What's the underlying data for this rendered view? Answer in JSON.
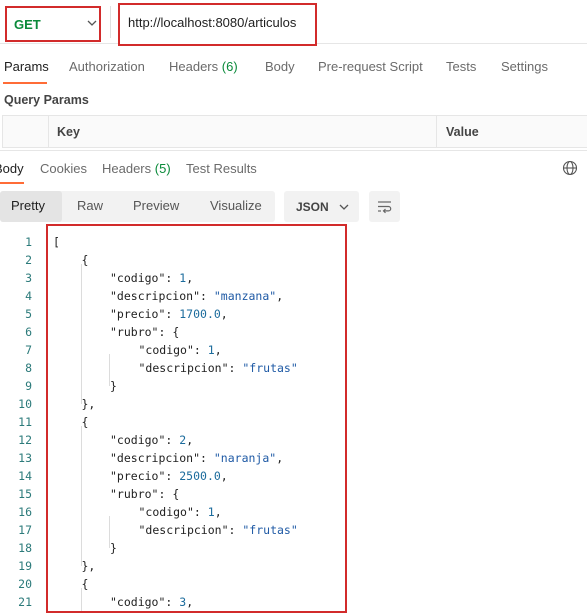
{
  "request": {
    "method": "GET",
    "url": "http://localhost:8080/articulos"
  },
  "request_tabs": [
    {
      "label": "Params",
      "count": ""
    },
    {
      "label": "Authorization",
      "count": ""
    },
    {
      "label": "Headers",
      "count": "(6)"
    },
    {
      "label": "Body",
      "count": ""
    },
    {
      "label": "Pre-request Script",
      "count": ""
    },
    {
      "label": "Tests",
      "count": ""
    },
    {
      "label": "Settings",
      "count": ""
    }
  ],
  "query_params": {
    "title": "Query Params",
    "columns": [
      "Key",
      "Value"
    ]
  },
  "response_tabs": [
    {
      "label": "Body",
      "count": ""
    },
    {
      "label": "Cookies",
      "count": ""
    },
    {
      "label": "Headers",
      "count": "(5)"
    },
    {
      "label": "Test Results",
      "count": ""
    }
  ],
  "view_modes": [
    "Pretty",
    "Raw",
    "Preview",
    "Visualize"
  ],
  "format": "JSON",
  "line_numbers": [
    "1",
    "2",
    "3",
    "4",
    "5",
    "6",
    "7",
    "8",
    "9",
    "10",
    "11",
    "12",
    "13",
    "14",
    "15",
    "16",
    "17",
    "18",
    "19",
    "20",
    "21"
  ],
  "code_lines": [
    {
      "indent": 0,
      "parts": [
        [
          "p",
          "["
        ]
      ]
    },
    {
      "indent": 1,
      "parts": [
        [
          "p",
          "{"
        ]
      ]
    },
    {
      "indent": 2,
      "parts": [
        [
          "k",
          "\"codigo\""
        ],
        [
          "p",
          ": "
        ],
        [
          "n",
          "1"
        ],
        [
          "p",
          ","
        ]
      ]
    },
    {
      "indent": 2,
      "parts": [
        [
          "k",
          "\"descripcion\""
        ],
        [
          "p",
          ": "
        ],
        [
          "s",
          "\"manzana\""
        ],
        [
          "p",
          ","
        ]
      ]
    },
    {
      "indent": 2,
      "parts": [
        [
          "k",
          "\"precio\""
        ],
        [
          "p",
          ": "
        ],
        [
          "n",
          "1700.0"
        ],
        [
          "p",
          ","
        ]
      ]
    },
    {
      "indent": 2,
      "parts": [
        [
          "k",
          "\"rubro\""
        ],
        [
          "p",
          ": {"
        ]
      ]
    },
    {
      "indent": 3,
      "parts": [
        [
          "k",
          "\"codigo\""
        ],
        [
          "p",
          ": "
        ],
        [
          "n",
          "1"
        ],
        [
          "p",
          ","
        ]
      ]
    },
    {
      "indent": 3,
      "parts": [
        [
          "k",
          "\"descripcion\""
        ],
        [
          "p",
          ": "
        ],
        [
          "s",
          "\"frutas\""
        ]
      ]
    },
    {
      "indent": 2,
      "parts": [
        [
          "p",
          "}"
        ]
      ]
    },
    {
      "indent": 1,
      "parts": [
        [
          "p",
          "},"
        ]
      ]
    },
    {
      "indent": 1,
      "parts": [
        [
          "p",
          "{"
        ]
      ]
    },
    {
      "indent": 2,
      "parts": [
        [
          "k",
          "\"codigo\""
        ],
        [
          "p",
          ": "
        ],
        [
          "n",
          "2"
        ],
        [
          "p",
          ","
        ]
      ]
    },
    {
      "indent": 2,
      "parts": [
        [
          "k",
          "\"descripcion\""
        ],
        [
          "p",
          ": "
        ],
        [
          "s",
          "\"naranja\""
        ],
        [
          "p",
          ","
        ]
      ]
    },
    {
      "indent": 2,
      "parts": [
        [
          "k",
          "\"precio\""
        ],
        [
          "p",
          ": "
        ],
        [
          "n",
          "2500.0"
        ],
        [
          "p",
          ","
        ]
      ]
    },
    {
      "indent": 2,
      "parts": [
        [
          "k",
          "\"rubro\""
        ],
        [
          "p",
          ": {"
        ]
      ]
    },
    {
      "indent": 3,
      "parts": [
        [
          "k",
          "\"codigo\""
        ],
        [
          "p",
          ": "
        ],
        [
          "n",
          "1"
        ],
        [
          "p",
          ","
        ]
      ]
    },
    {
      "indent": 3,
      "parts": [
        [
          "k",
          "\"descripcion\""
        ],
        [
          "p",
          ": "
        ],
        [
          "s",
          "\"frutas\""
        ]
      ]
    },
    {
      "indent": 2,
      "parts": [
        [
          "p",
          "}"
        ]
      ]
    },
    {
      "indent": 1,
      "parts": [
        [
          "p",
          "},"
        ]
      ]
    },
    {
      "indent": 1,
      "parts": [
        [
          "p",
          "{"
        ]
      ]
    },
    {
      "indent": 2,
      "parts": [
        [
          "k",
          "\"codigo\""
        ],
        [
          "p",
          ": "
        ],
        [
          "n",
          "3"
        ],
        [
          "p",
          ","
        ]
      ]
    }
  ],
  "colors": {
    "accent_tab": "#ff6c37",
    "method_green": "#0a8a3a",
    "highlight_red": "#d22b2b"
  },
  "icons": {
    "globe": "globe-icon",
    "wrap": "wrap-lines-icon",
    "chevron": "chevron-down-icon"
  }
}
